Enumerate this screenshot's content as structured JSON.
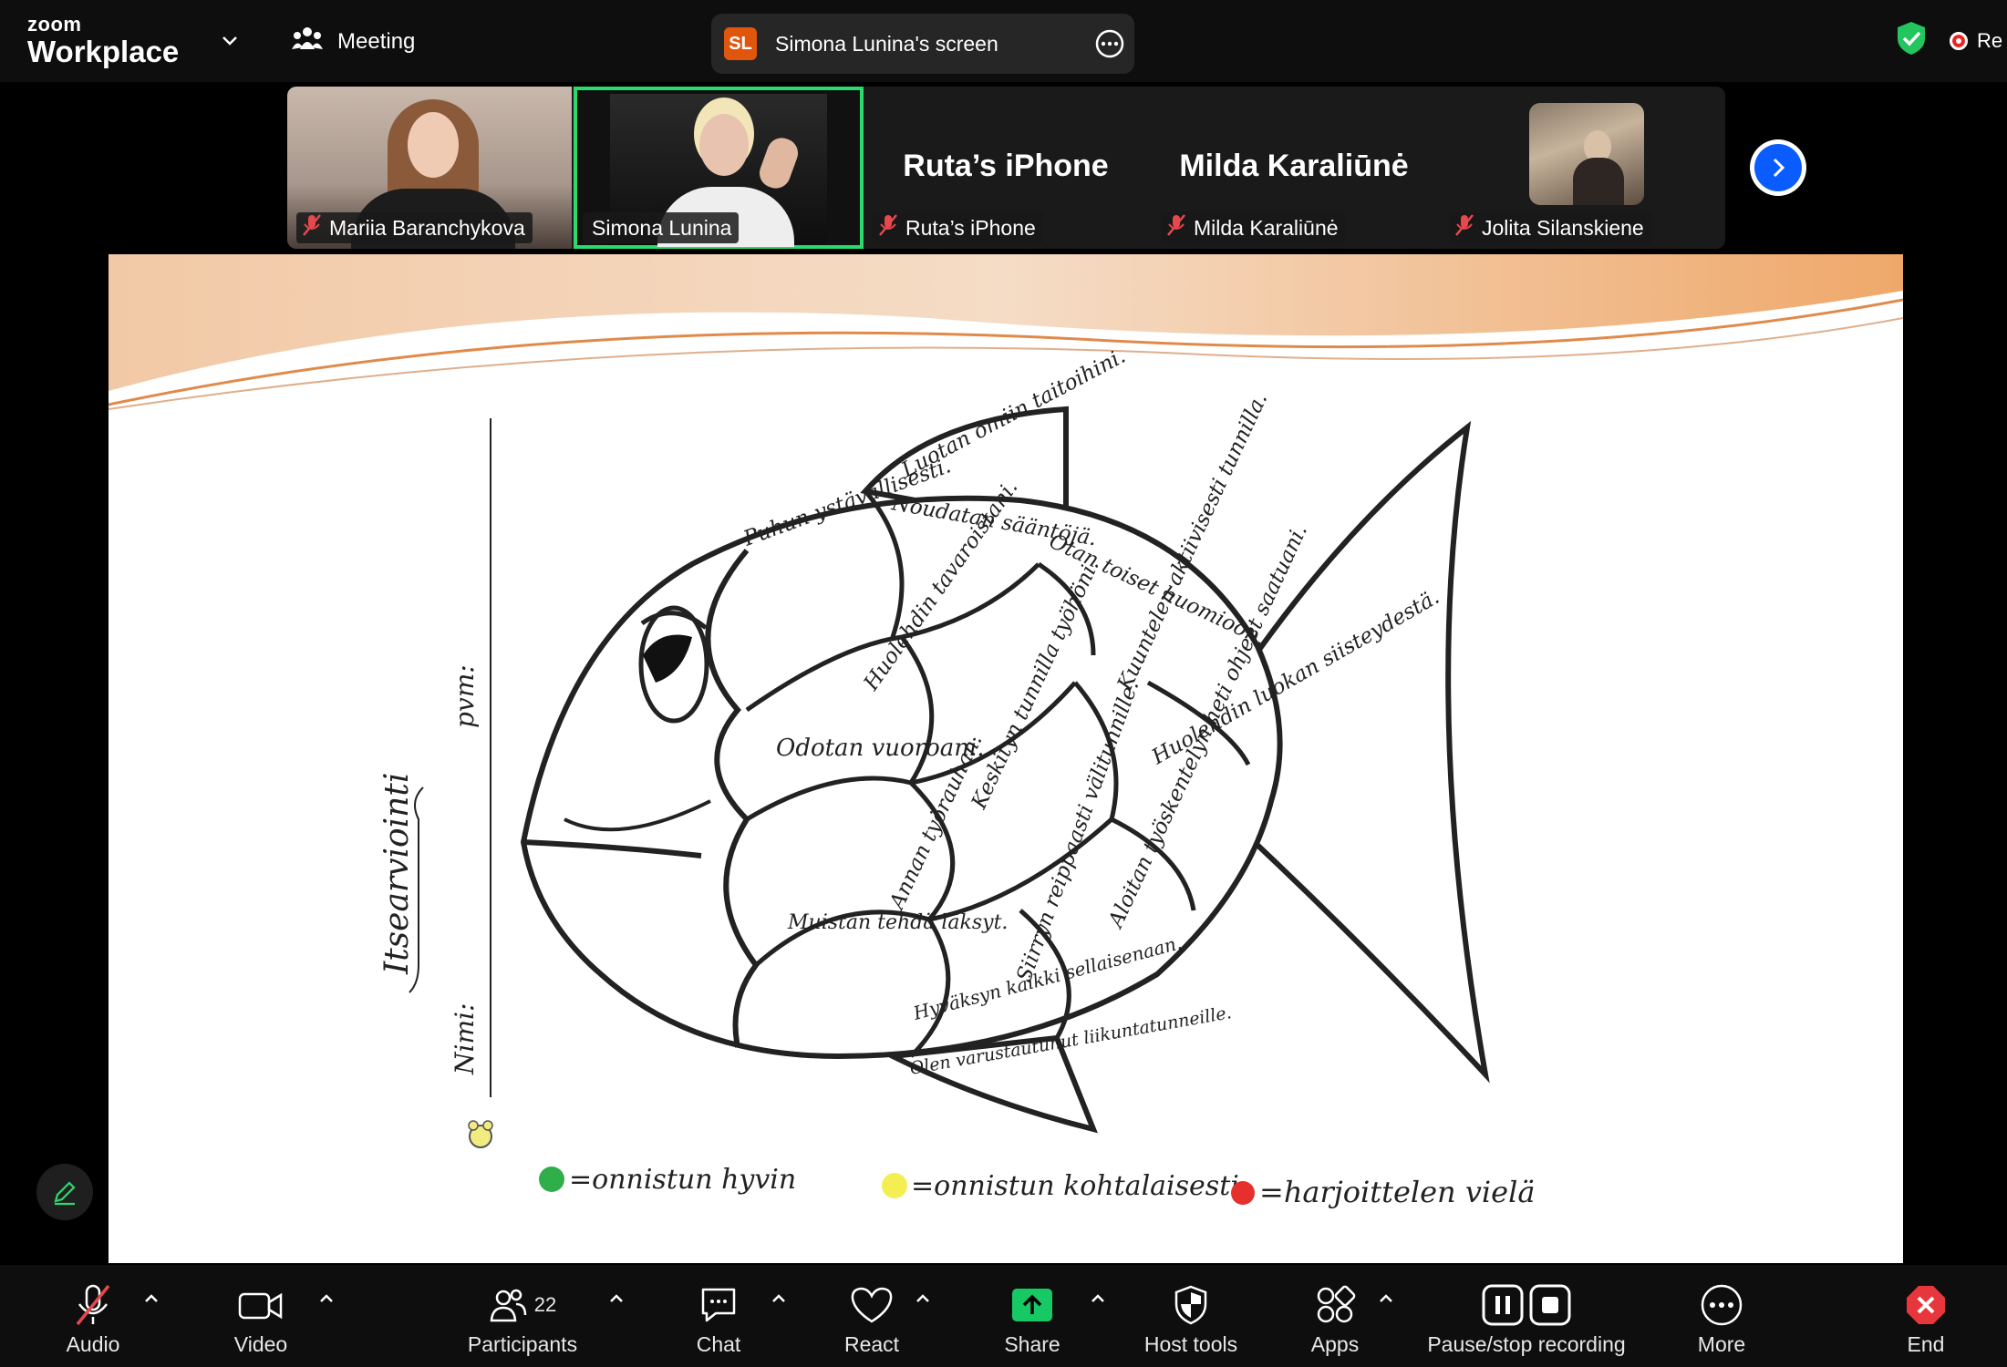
{
  "topbar": {
    "logo_line1": "zoom",
    "logo_line2": "Workplace",
    "meeting_label": "Meeting",
    "screen_badge": "SL",
    "screen_title": "Simona Lunina's screen",
    "recording_label": "Re"
  },
  "participants_strip": [
    {
      "name": "Mariia Baranchykova",
      "video": true,
      "muted": true
    },
    {
      "name": "Simona Lunina",
      "video": true,
      "active": true,
      "muted": false
    },
    {
      "name": "Ruta’s iPhone",
      "display": "Ruta’s iPhone",
      "video": false,
      "muted": true
    },
    {
      "name": "Milda Karaliūnė",
      "display": "Milda Karaliūnė",
      "video": false,
      "muted": true
    },
    {
      "name": "Jolita Silanskiene",
      "video": true,
      "muted": true
    }
  ],
  "worksheet": {
    "title_side": "Itsearviointi",
    "pvm": "pvm:",
    "nimi": "Nimi:",
    "scales": [
      "Luotan omiin taitoihini.",
      "Puhun ystävällisesti.",
      "Noudatan sääntöjä.",
      "Otan toiset huomioon.",
      "Huolehdin tavaroistani.",
      "Odotan vuoroani.",
      "Kuuntelen aktiivisesti tunnilla.",
      "Keskityn tunnilla työhöni.",
      "Huolehdin luokan siisteydestä.",
      "Annan työrauhan.",
      "Aloitan työskentelyn heti ohjeet saatuani.",
      "Muistan tehdä läksyt.",
      "Siirryn reippaasti välitunnille.",
      "Hyväksyn kaikki sellaisenaan.",
      "Olen varustautunut liikuntatunneille."
    ],
    "legend": [
      {
        "color": "#2fae4a",
        "text": "=onnistun hyvin"
      },
      {
        "color": "#f4ee52",
        "text": "=onnistun kohtalaisesti"
      },
      {
        "color": "#e5302c",
        "text": "=harjoittelen vielä"
      }
    ]
  },
  "toolbar": {
    "audio": "Audio",
    "video": "Video",
    "participants": "Participants",
    "participants_count": "22",
    "chat": "Chat",
    "react": "React",
    "share": "Share",
    "host_tools": "Host tools",
    "apps": "Apps",
    "recording": "Pause/stop recording",
    "more": "More",
    "end": "End"
  },
  "colors": {
    "accent_green": "#2bd96c",
    "share_green": "#17c964",
    "zoom_blue": "#0b5cff",
    "end_red": "#e8373c",
    "badge_orange": "#e0560d"
  }
}
